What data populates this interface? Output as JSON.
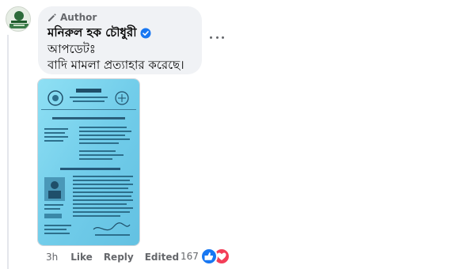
{
  "comment": {
    "author_label": "Author",
    "author_name": "মনিরুল হক চৌধুরী",
    "verified": true,
    "text_lines": [
      "আপডেটঃ",
      "বাদি মামলা প্রত্যাহার করেছে।"
    ]
  },
  "attachment": {
    "kind": "document-photo"
  },
  "actions": {
    "time": "3h",
    "like_label": "Like",
    "reply_label": "Reply",
    "edited_label": "Edited"
  },
  "reactions": {
    "count": "167",
    "types": [
      "like",
      "love"
    ]
  },
  "colors": {
    "bubble_bg": "#f0f2f5",
    "like_blue": "#1877f2",
    "love_red": "#f33e58",
    "meta_gray": "#65676b",
    "document_blue": "#7fd3ee"
  }
}
